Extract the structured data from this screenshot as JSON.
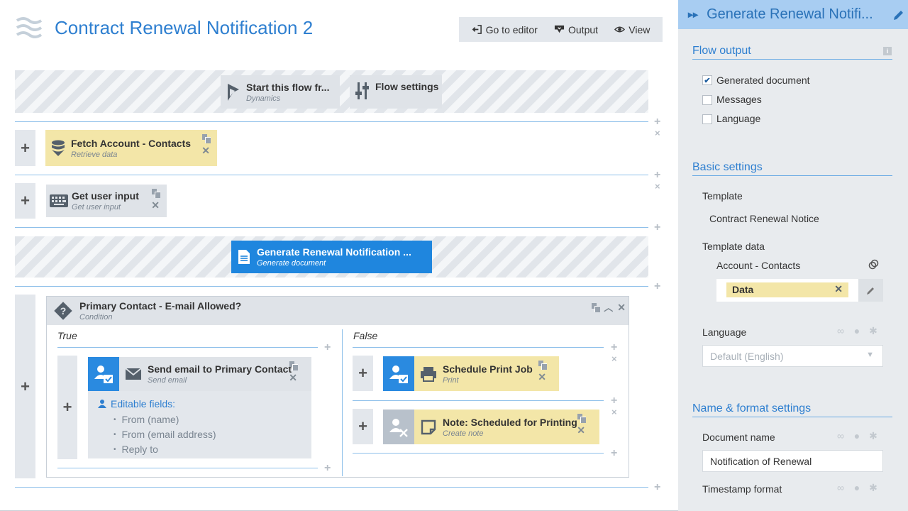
{
  "header": {
    "title": "Contract Renewal Notification 2",
    "toolbar": {
      "go_to_editor": "Go to editor",
      "output": "Output",
      "view": "View"
    }
  },
  "flow": {
    "start": {
      "title": "Start this flow fr...",
      "subtitle": "Dynamics"
    },
    "settings": {
      "title": "Flow settings"
    },
    "fetch": {
      "title": "Fetch Account - Contacts",
      "subtitle": "Retrieve data"
    },
    "user_input": {
      "title": "Get user input",
      "subtitle": "Get user input"
    },
    "generate": {
      "title": "Generate Renewal Notification ...",
      "subtitle": "Generate document"
    },
    "condition": {
      "title": "Primary Contact - E-mail Allowed?",
      "subtitle": "Condition",
      "true_label": "True",
      "false_label": "False",
      "send_email": {
        "title": "Send email to Primary Contact",
        "subtitle": "Send email",
        "editable_label": "Editable fields:",
        "fields": [
          "From (name)",
          "From (email address)",
          "Reply to"
        ]
      },
      "print_job": {
        "title": "Schedule Print Job",
        "subtitle": "Print"
      },
      "note": {
        "title": "Note: Scheduled for Printing",
        "subtitle": "Create note"
      }
    }
  },
  "panel": {
    "title": "Generate Renewal Notifi...",
    "flow_output": {
      "heading": "Flow output",
      "options": [
        {
          "label": "Generated document",
          "checked": true
        },
        {
          "label": "Messages",
          "checked": false
        },
        {
          "label": "Language",
          "checked": false
        }
      ]
    },
    "basic": {
      "heading": "Basic settings",
      "template_label": "Template",
      "template_value": "Contract Renewal Notice",
      "template_data_label": "Template data",
      "account_contacts": "Account - Contacts",
      "data_tag": "Data",
      "language_label": "Language",
      "language_value": "Default (English)"
    },
    "name_format": {
      "heading": "Name & format settings",
      "doc_name_label": "Document name",
      "doc_name_value": "Notification of Renewal",
      "timestamp_label": "Timestamp format"
    }
  },
  "colors": {
    "accent": "#2e7fd0",
    "step_yellow": "#f3e6a8",
    "step_blue": "#1f86de",
    "panel_header": "#a8cdf2"
  }
}
